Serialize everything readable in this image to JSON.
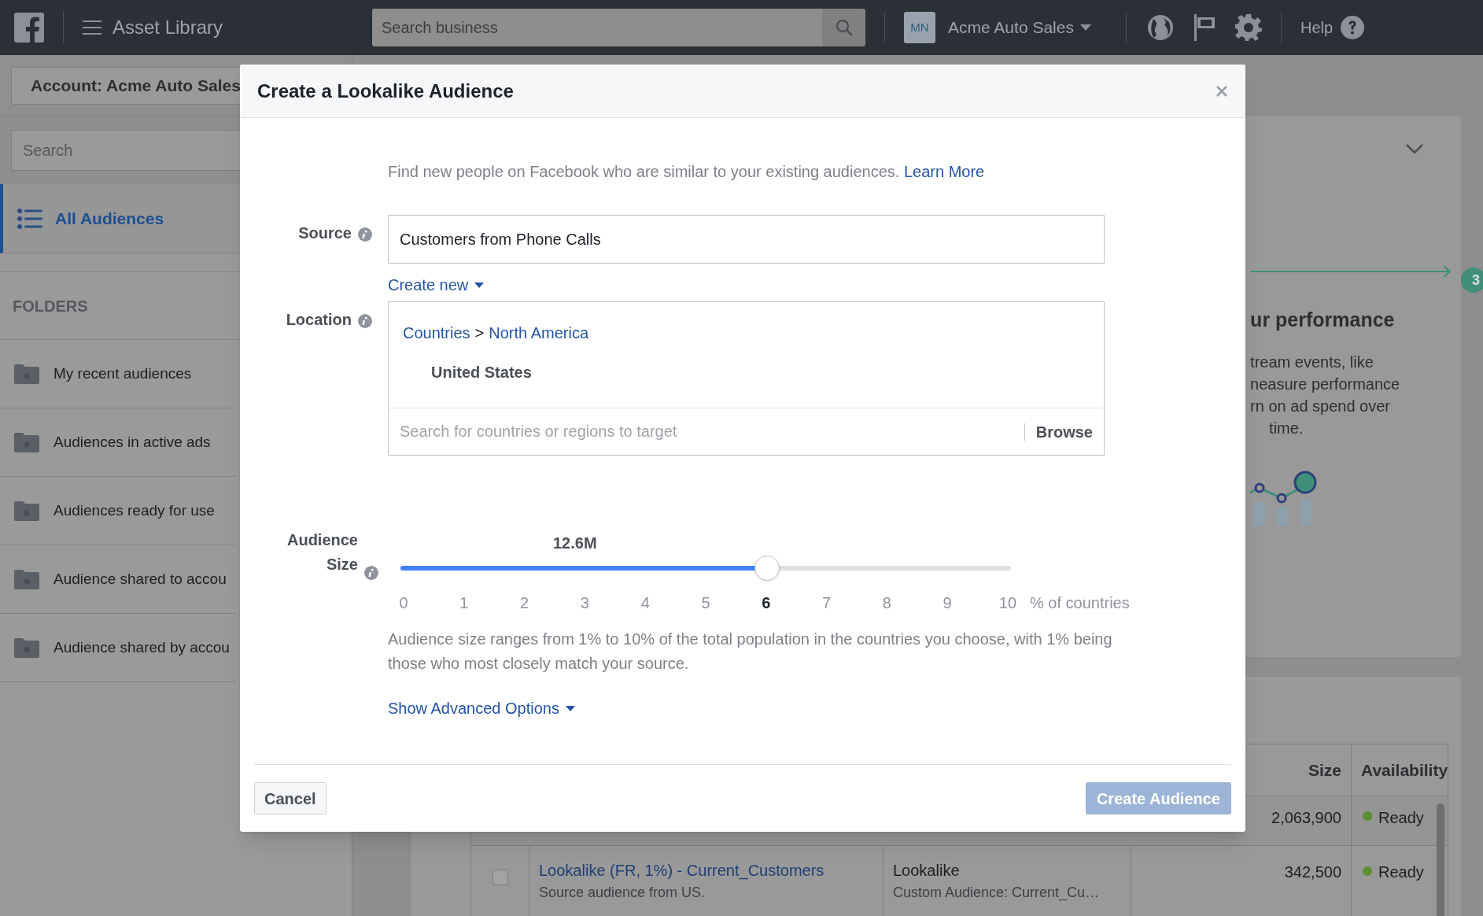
{
  "top_bar": {
    "title": "Asset Library",
    "search": {
      "placeholder": "Search business"
    },
    "account": {
      "initials": "MN",
      "name": "Acme Auto Sales"
    },
    "help": "Help"
  },
  "sidebar": {
    "account_button": "Account: Acme Auto Sales",
    "search": {
      "placeholder": "Search"
    },
    "items": [
      {
        "label": "All Audiences",
        "selected": true
      }
    ],
    "folders_heading": "FOLDERS",
    "folders": [
      {
        "label": "My recent audiences",
        "selected": false
      },
      {
        "label": "Audiences in active ads",
        "selected": false
      },
      {
        "label": "Audiences ready for use",
        "selected": false
      },
      {
        "label": "Audience shared to accou",
        "selected": false
      },
      {
        "label": "Audience shared by accou",
        "selected": false
      }
    ]
  },
  "info_card": {
    "step": "3",
    "heading": "ur performance",
    "lines": [
      "tream events, like",
      "neasure performance",
      "rn on ad spend over",
      "time."
    ]
  },
  "table": {
    "columns": [
      "Size",
      "Availability"
    ],
    "rows": [
      {
        "size": "2,063,900",
        "availability": "Ready",
        "color": "#5a8f2e"
      },
      {
        "checked": false,
        "name": "Lookalike (FR, 1%) - Current_Customers",
        "description": "Source audience from US.",
        "type": "Lookalike",
        "subtype": "Custom Audience: Current_Cu…",
        "size": "342,500",
        "availability": "Ready",
        "color": "#5a8f2e"
      }
    ]
  },
  "dialog": {
    "title": "Create a Lookalike Audience",
    "intro": "Find new people on Facebook who are similar to your existing audiences.",
    "learn_more": "Learn More",
    "source": {
      "label": "Source",
      "value": "Customers from Phone Calls",
      "create_new": "Create new"
    },
    "location": {
      "label": "Location",
      "breadcrumb": [
        "Countries",
        "North America"
      ],
      "separator": ">",
      "selected": "United States",
      "placeholder": "Search for countries or regions to target",
      "browse": "Browse"
    },
    "audience_size": {
      "label": [
        "Audience",
        "Size"
      ],
      "estimate": "12.6M",
      "level": 0.6,
      "ticks": [
        {
          "label": "0",
          "selected": false
        },
        {
          "label": "1",
          "selected": false
        },
        {
          "label": "2",
          "selected": false
        },
        {
          "label": "3",
          "selected": false
        },
        {
          "label": "4",
          "selected": false
        },
        {
          "label": "5",
          "selected": false
        },
        {
          "label": "6",
          "selected": true
        },
        {
          "label": "7",
          "selected": false
        },
        {
          "label": "8",
          "selected": false
        },
        {
          "label": "9",
          "selected": false
        },
        {
          "label": "10",
          "selected": false
        }
      ],
      "unit": "% of countries",
      "description": "Audience size ranges from 1% to 10% of the total population in the countries you choose, with 1% being those who most closely match your source."
    },
    "advanced": "Show Advanced Options",
    "cancel": "Cancel",
    "create": {
      "label": "Create Audience",
      "disabled": true
    }
  }
}
